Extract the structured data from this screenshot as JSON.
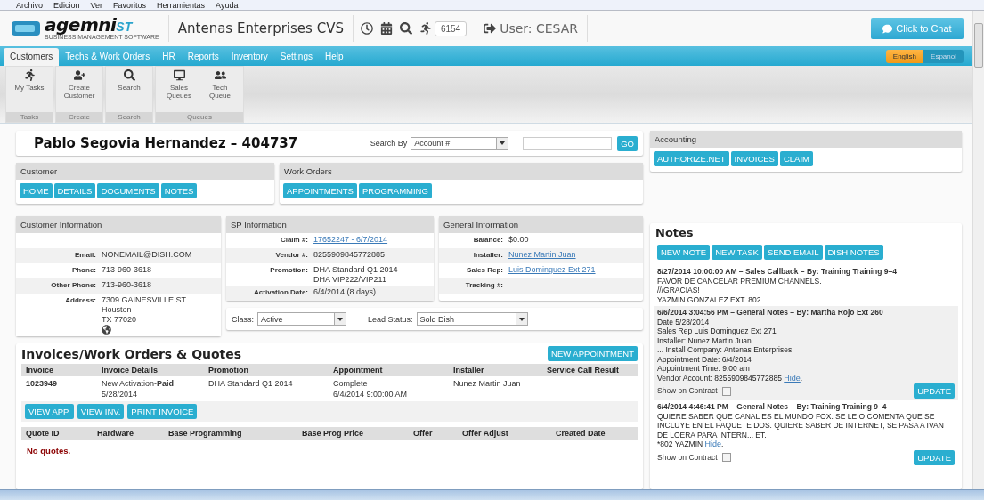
{
  "menu_bar": [
    "Archivo",
    "Edicion",
    "Ver",
    "Favoritos",
    "Herramientas",
    "Ayuda"
  ],
  "header": {
    "logo": {
      "name": "agemni",
      "suffix": "ST",
      "tagline": "BUSINESS MANAGEMENT SOFTWARE"
    },
    "company": "Antenas Enterprises CVS",
    "task_count": "6154",
    "user": "User: CESAR",
    "chat_button": "Click to Chat"
  },
  "nav_tabs": [
    {
      "label": "Customers",
      "selected": true
    },
    {
      "label": "Techs & Work Orders",
      "selected": false
    },
    {
      "label": "HR",
      "selected": false
    },
    {
      "label": "Reports",
      "selected": false
    },
    {
      "label": "Inventory",
      "selected": false
    },
    {
      "label": "Settings",
      "selected": false
    },
    {
      "label": "Help",
      "selected": false
    }
  ],
  "languages": [
    {
      "label": "English",
      "selected": true
    },
    {
      "label": "Espanol",
      "selected": false
    }
  ],
  "ribbon": [
    {
      "group": "Tasks",
      "items": [
        {
          "label": "My Tasks",
          "kind": "tasks"
        }
      ]
    },
    {
      "group": "Create",
      "items": [
        {
          "label": "Create Customer",
          "kind": "create"
        }
      ]
    },
    {
      "group": "Search",
      "items": [
        {
          "label": "Search",
          "kind": "search"
        }
      ]
    },
    {
      "group": "Queues",
      "items": [
        {
          "label": "Sales Queues",
          "kind": "sales"
        },
        {
          "label": "Tech Queue",
          "kind": "tech"
        }
      ]
    }
  ],
  "customer_title": "Pablo Segovia Hernandez – 404737",
  "search": {
    "label": "Search By",
    "select": "Account #",
    "button": "GO"
  },
  "customer_panel": {
    "title": "Customer",
    "buttons": [
      "HOME",
      "DETAILS",
      "DOCUMENTS",
      "NOTES"
    ]
  },
  "work_orders_panel": {
    "title": "Work Orders",
    "buttons": [
      "APPOINTMENTS",
      "PROGRAMMING"
    ]
  },
  "accounting_panel": {
    "title": "Accounting",
    "buttons": [
      "AUTHORIZE.NET",
      "INVOICES",
      "CLAIM"
    ]
  },
  "info_panels": [
    {
      "title": "Customer Information",
      "rows": [
        {
          "kind": "spacer"
        },
        {
          "kind": "field",
          "label": "Email:",
          "lines": [
            "NONEMAIL@DISH.COM"
          ]
        },
        {
          "kind": "field",
          "label": "Phone:",
          "lines": [
            "713-960-3618"
          ]
        },
        {
          "kind": "field",
          "label": "Other Phone:",
          "lines": [
            "713-960-3618"
          ]
        },
        {
          "kind": "address",
          "label": "Address:",
          "lines": [
            "7309 GAINESVILLE ST",
            "Houston",
            "TX 77020"
          ]
        }
      ]
    },
    {
      "title": "SP Information",
      "rows": [
        {
          "kind": "link",
          "label": "Claim #:",
          "lines": [
            "17652247 - 6/7/2014"
          ]
        },
        {
          "kind": "field",
          "label": "Vendor #:",
          "lines": [
            "8255909845772885"
          ]
        },
        {
          "kind": "field",
          "label": "Promotion:",
          "lines": [
            "DHA Standard Q1 2014",
            "DHA VIP222/VIP211"
          ]
        },
        {
          "kind": "field",
          "label": "Activation Date:",
          "lines": [
            "6/4/2014  (8 days)"
          ]
        }
      ]
    },
    {
      "title": "General Information",
      "rows": [
        {
          "kind": "field",
          "label": "Balance:",
          "lines": [
            "$0.00"
          ]
        },
        {
          "kind": "link",
          "label": "Installer:",
          "lines": [
            "Nunez Martin Juan"
          ]
        },
        {
          "kind": "link",
          "label": "Sales Rep:",
          "lines": [
            "Luis Dominguez Ext 271"
          ]
        },
        {
          "kind": "field",
          "label": "Tracking #:",
          "lines": []
        }
      ]
    }
  ],
  "status_selects": [
    {
      "label": "Class:",
      "value": "Active"
    },
    {
      "label": "Lead Status:",
      "value": "Sold Dish"
    }
  ],
  "invoices": {
    "title": "Invoices/Work Orders & Quotes",
    "new_button": "NEW APPOINTMENT",
    "columns": [
      "Invoice",
      "Invoice Details",
      "Promotion",
      "Appointment",
      "Installer",
      "Service Call Result"
    ],
    "rows": [
      [
        [
          "1023949"
        ],
        [
          "New Activation-**Paid**",
          "5/28/2014"
        ],
        [
          "DHA Standard Q1 2014"
        ],
        [
          "Complete",
          "6/4/2014 9:00:00 AM"
        ],
        [
          "Nunez Martin Juan"
        ],
        []
      ]
    ],
    "actions": [
      "VIEW APP.",
      "VIEW INV.",
      "PRINT INVOICE"
    ],
    "quote_columns": [
      "Quote ID",
      "Hardware",
      "Base Programming",
      "Base Prog Price",
      "Offer",
      "Offer Adjust",
      "Created Date"
    ],
    "empty_message": "No quotes."
  },
  "notes": {
    "title": "Notes",
    "buttons": [
      "NEW NOTE",
      "NEW TASK",
      "SEND EMAIL",
      "DISH NOTES"
    ],
    "items": [
      {
        "header": "8/27/2014 10:00:00 AM – Sales Callback – By: Training Training 9–4",
        "lines": [
          "FAVOR DE CANCELAR PREMIUM CHANNELS.",
          "///GRACIAS!",
          "YAZMIN GONZALEZ EXT. 802."
        ]
      },
      {
        "header": "6/6/2014 3:04:56 PM – General Notes – By: Martha Rojo Ext 260",
        "lines": [
          "Date 5/28/2014",
          "Sales Rep Luis Dominguez Ext 271",
          "Installer: Nunez Martin Juan",
          "... Install Company: Antenas Enterprises",
          "Appointment Date: 6/4/2014",
          "Appointment Time: 9:00 am"
        ],
        "last_line": "Vendor Account: 8255909845772885",
        "hide": "Hide",
        "hide_end": ".",
        "contract": {
          "label": "Show on Contract",
          "checked": false
        },
        "update": "UPDATE"
      },
      {
        "header": "6/4/2014 4:46:41 PM – General Notes – By: Training Training 9–4",
        "lines": [
          "QUIERE SABER QUE CANAL ES EL MUNDO FOX. SE LE O COMENTA QUE SE INCLUYE EN EL PAQUETE DOS. QUIERE SABER DE INTERNET, SE PASA A IVAN DE LOERA PARA INTERN... ET."
        ],
        "last_line": "*802 YAZMIN",
        "hide": "Hide",
        "hide_end": ".",
        "contract": {
          "label": "Show on Contract",
          "checked": false
        },
        "update": "UPDATE"
      }
    ]
  }
}
